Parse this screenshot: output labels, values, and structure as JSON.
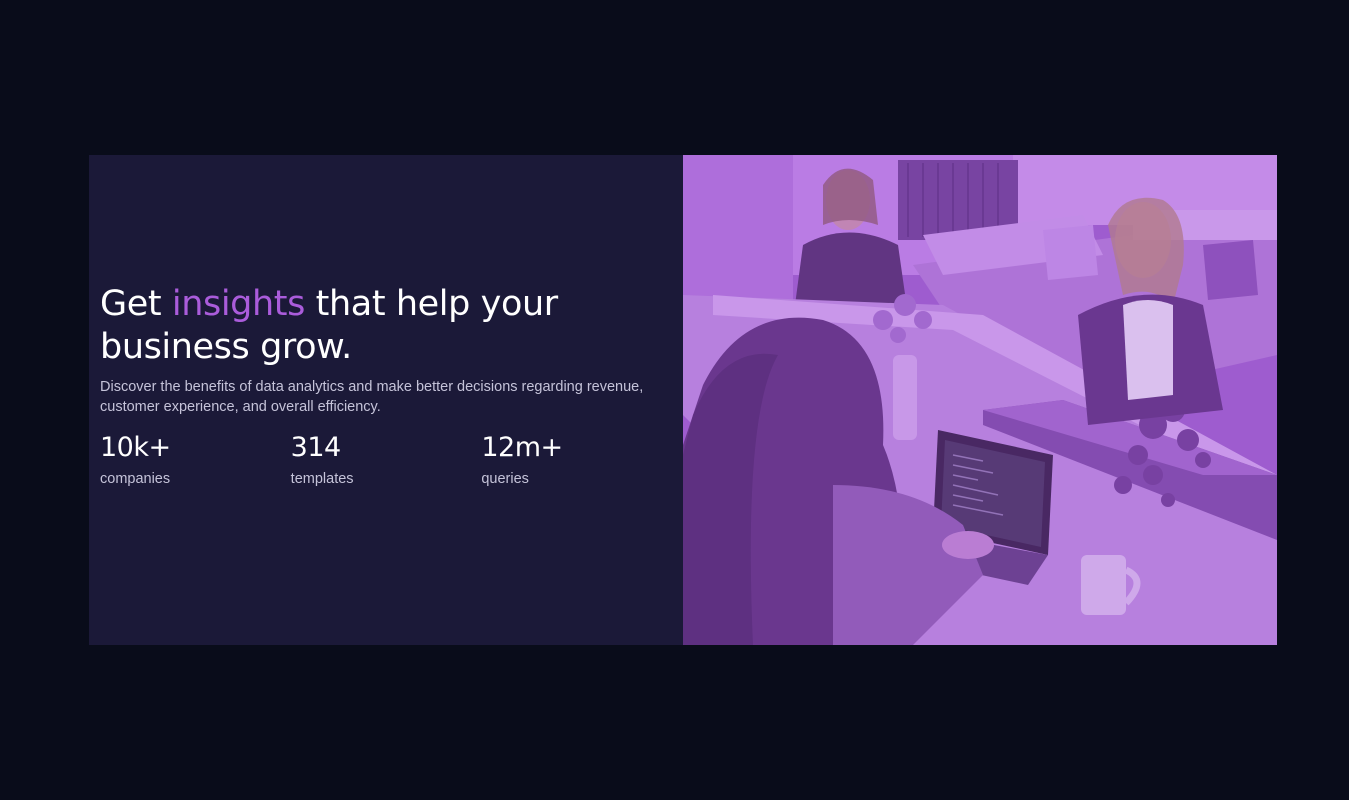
{
  "hero": {
    "title_pre": "Get ",
    "title_accent": "insights",
    "title_post": " that help your business grow.",
    "description": "Discover the benefits of data analytics and make better decisions regarding revenue, customer experience, and overall efficiency."
  },
  "stats": [
    {
      "value": "10k+",
      "label": "companies"
    },
    {
      "value": "314",
      "label": "templates"
    },
    {
      "value": "12m+",
      "label": "queries"
    }
  ],
  "colors": {
    "background": "#090c1a",
    "card": "#1b1938",
    "accent": "#aa5cdb",
    "image_overlay": "#9b59cc"
  }
}
